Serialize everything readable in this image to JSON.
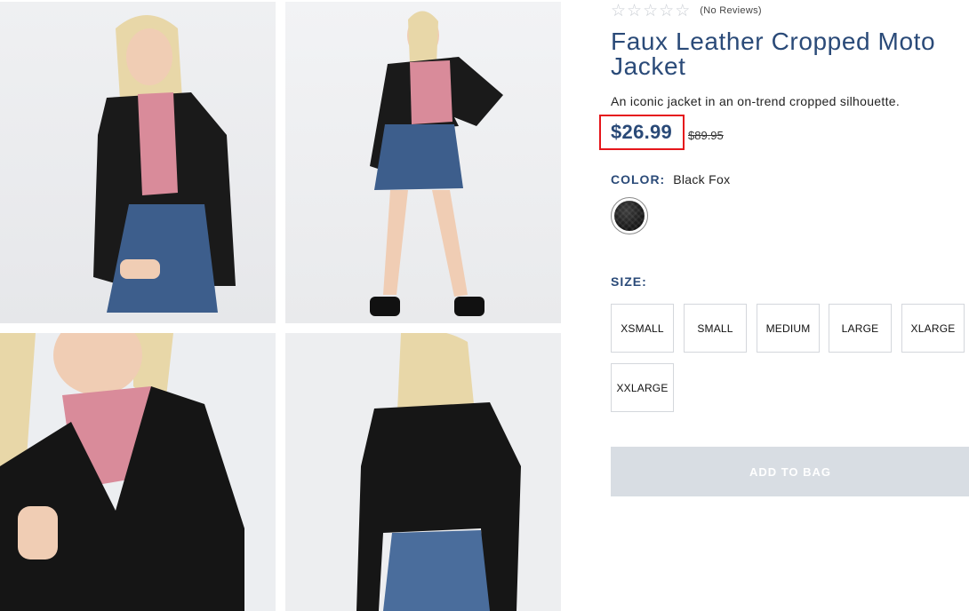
{
  "rating": {
    "stars_filled": 0,
    "stars_total": 5,
    "reviews_text": "(No Reviews)"
  },
  "product": {
    "title": "Faux Leather Cropped Moto Jacket",
    "description": "An iconic jacket in an on-trend cropped silhouette.",
    "price": "$26.99",
    "original_price": "$89.95"
  },
  "color": {
    "label": "COLOR:",
    "value": "Black Fox"
  },
  "size": {
    "label": "SIZE:",
    "options": [
      "XSMALL",
      "SMALL",
      "MEDIUM",
      "LARGE",
      "XLARGE",
      "XXLARGE"
    ]
  },
  "actions": {
    "add_to_bag": "ADD TO BAG"
  },
  "colors": {
    "brand_blue": "#2a4a78",
    "highlight_red": "#e5161b",
    "disabled_button": "#d8dde3"
  }
}
